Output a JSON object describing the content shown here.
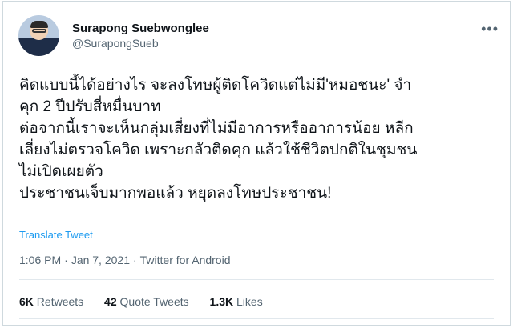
{
  "author": {
    "name": "Surapong Suebwonglee",
    "handle": "@SurapongSueb"
  },
  "menu_icon": "more-horizontal-icon",
  "tweet_lines": [
    "คิดแบบนี้ได้อย่างไร จะลงโทษผู้ติดโควิดแต่ไม่มี'หมอชนะ' จำ",
    "คุก 2 ปีปรับสี่หมื่นบาท",
    "ต่อจากนี้เราจะเห็นกลุ่มเสี่ยงที่ไม่มีอาการหรืออาการน้อย หลีก",
    "เลี่ยงไม่ตรวจโควิด เพราะกลัวติดคุก แล้วใช้ชีวิตปกติในชุมชน",
    "ไม่เปิดเผยตัว",
    "ประชาชนเจ็บมากพอแล้ว หยุดลงโทษประชาชน!"
  ],
  "translate_label": "Translate Tweet",
  "meta": {
    "time": "1:06 PM",
    "date": "Jan 7, 2021",
    "source": "Twitter for Android",
    "separator": "·"
  },
  "stats": {
    "retweets_count": "6K",
    "retweets_label": "Retweets",
    "quotes_count": "42",
    "quotes_label": "Quote Tweets",
    "likes_count": "1.3K",
    "likes_label": "Likes"
  },
  "colors": {
    "link": "#1d9bf0",
    "secondary_text": "#536471",
    "primary_text": "#0f1419",
    "border": "#cfd9de"
  }
}
